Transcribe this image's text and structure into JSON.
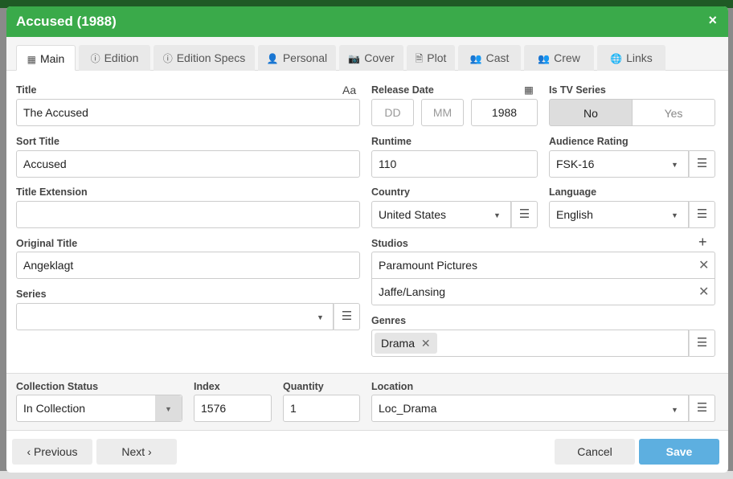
{
  "window": {
    "title": "Accused (1988)",
    "close": "×"
  },
  "tabs": [
    {
      "label": "Main",
      "icon": "film-icon",
      "glyph": "▦"
    },
    {
      "label": "Edition",
      "icon": "info-icon",
      "glyph": "ⓘ"
    },
    {
      "label": "Edition Specs",
      "icon": "info-icon",
      "glyph": "ⓘ"
    },
    {
      "label": "Personal",
      "icon": "person-icon",
      "glyph": "👤"
    },
    {
      "label": "Cover",
      "icon": "camera-icon",
      "glyph": "📷"
    },
    {
      "label": "Plot",
      "icon": "document-icon",
      "glyph": "🗎"
    },
    {
      "label": "Cast",
      "icon": "users-icon",
      "glyph": "👥"
    },
    {
      "label": "Crew",
      "icon": "users-icon",
      "glyph": "👥"
    },
    {
      "label": "Links",
      "icon": "globe-icon",
      "glyph": "🌐"
    }
  ],
  "fields": {
    "title": {
      "label": "Title",
      "value": "The Accused",
      "icon": "Aa"
    },
    "sort_title": {
      "label": "Sort Title",
      "value": "Accused"
    },
    "title_extension": {
      "label": "Title Extension",
      "value": ""
    },
    "original_title": {
      "label": "Original Title",
      "value": "Angeklagt"
    },
    "series": {
      "label": "Series",
      "value": ""
    },
    "release_date": {
      "label": "Release Date",
      "day": "DD",
      "month": "MM",
      "year": "1988"
    },
    "runtime": {
      "label": "Runtime",
      "value": "110"
    },
    "country": {
      "label": "Country",
      "value": "United States"
    },
    "studios": {
      "label": "Studios",
      "add": "+",
      "items": [
        "Paramount Pictures",
        "Jaffe/Lansing"
      ]
    },
    "genres": {
      "label": "Genres",
      "items": [
        "Drama"
      ]
    },
    "is_tv_series": {
      "label": "Is TV Series",
      "no": "No",
      "yes": "Yes"
    },
    "audience_rating": {
      "label": "Audience Rating",
      "value": "FSK-16"
    },
    "language": {
      "label": "Language",
      "value": "English"
    },
    "collection_status": {
      "label": "Collection Status",
      "value": "In Collection"
    },
    "index": {
      "label": "Index",
      "value": "1576"
    },
    "quantity": {
      "label": "Quantity",
      "value": "1"
    },
    "location": {
      "label": "Location",
      "value": "Loc_Drama"
    }
  },
  "footer": {
    "previous": "‹ Previous",
    "next": "Next ›",
    "cancel": "Cancel",
    "save": "Save"
  },
  "colors": {
    "header": "#3aaa4a",
    "save": "#5dafe0"
  }
}
